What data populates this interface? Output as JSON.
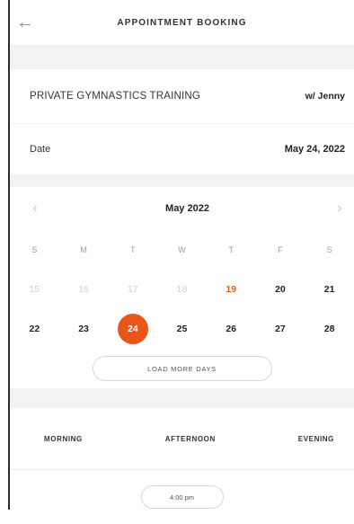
{
  "header": {
    "title": "APPOINTMENT BOOKING",
    "back_icon": "arrow-left-icon"
  },
  "service": {
    "name": "PRIVATE GYMNASTICS TRAINING",
    "trainer": "w/ Jenny"
  },
  "date": {
    "label": "Date",
    "value": "May 24, 2022"
  },
  "calendar": {
    "month": "May 2022",
    "prev_icon": "chevron-left-icon",
    "next_icon": "chevron-right-icon",
    "weekdays": [
      "S",
      "M",
      "T",
      "W",
      "T",
      "F",
      "S"
    ],
    "weeks": [
      [
        {
          "d": "15",
          "state": "muted"
        },
        {
          "d": "16",
          "state": "muted"
        },
        {
          "d": "17",
          "state": "muted"
        },
        {
          "d": "18",
          "state": "muted"
        },
        {
          "d": "19",
          "state": "accent"
        },
        {
          "d": "20",
          "state": "normal"
        },
        {
          "d": "21",
          "state": "normal"
        }
      ],
      [
        {
          "d": "22",
          "state": "normal"
        },
        {
          "d": "23",
          "state": "normal"
        },
        {
          "d": "24",
          "state": "selected"
        },
        {
          "d": "25",
          "state": "normal"
        },
        {
          "d": "26",
          "state": "normal"
        },
        {
          "d": "27",
          "state": "normal"
        },
        {
          "d": "28",
          "state": "normal"
        }
      ]
    ],
    "load_more": "LOAD MORE DAYS"
  },
  "periods": [
    "MORNING",
    "AFTERNOON",
    "EVENING"
  ],
  "slots": [
    "4:00 pm"
  ],
  "colors": {
    "accent": "#e8561a",
    "accent_text": "#e0621d"
  }
}
